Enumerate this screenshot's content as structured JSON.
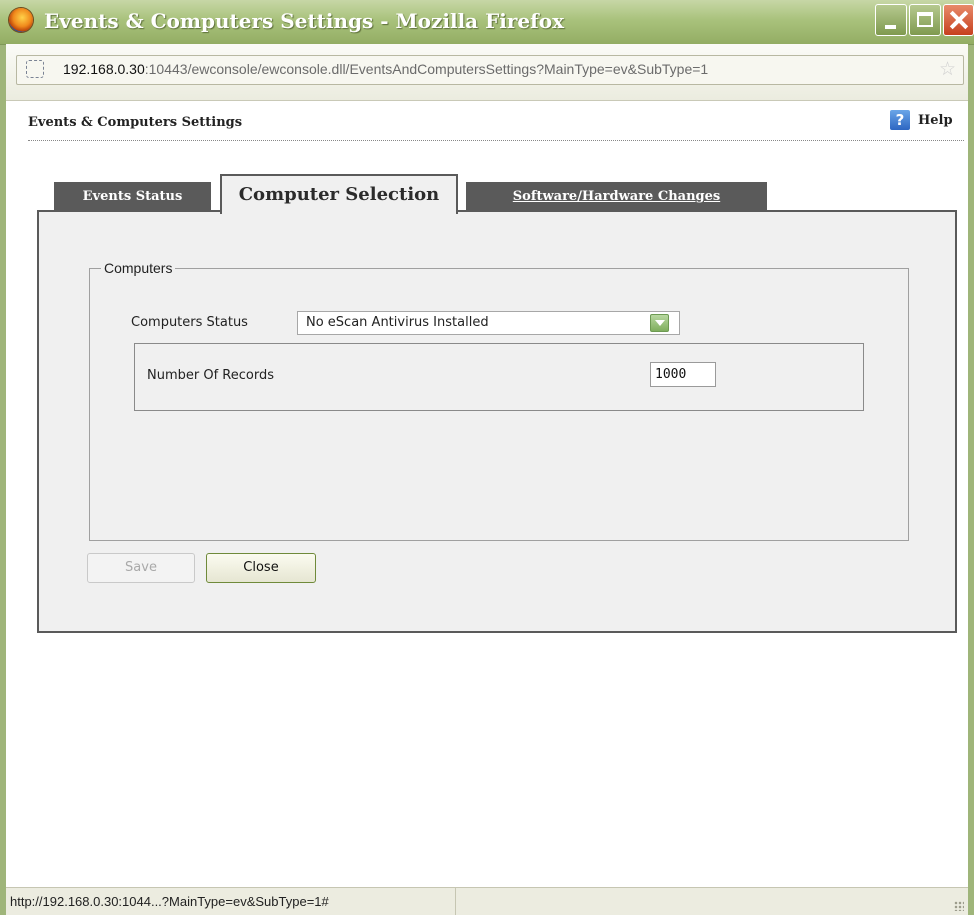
{
  "window": {
    "title": "Events & Computers Settings - Mozilla Firefox"
  },
  "addressbar": {
    "url_host": "192.168.0.30",
    "url_rest": ":10443/ewconsole/ewconsole.dll/EventsAndComputersSettings?MainType=ev&SubType=1"
  },
  "page": {
    "title": "Events & Computers Settings",
    "help_label": "Help",
    "help_icon_glyph": "?"
  },
  "tabs": [
    {
      "label": "Events Status",
      "state": "inactive"
    },
    {
      "label": "Computer Selection",
      "state": "active"
    },
    {
      "label": "Software/Hardware Changes",
      "state": "inactive-link"
    }
  ],
  "computers": {
    "legend": "Computers",
    "status_label": "Computers Status",
    "status_value": "No eScan Antivirus Installed",
    "records_label": "Number Of Records",
    "records_value": "1000"
  },
  "buttons": {
    "save_label": "Save",
    "close_label": "Close"
  },
  "statusbar": {
    "text": "http://192.168.0.30:1044...?MainType=ev&SubType=1#"
  },
  "colors": {
    "titlebar": "#a9c27c",
    "tab_inactive": "#5a5a5a",
    "panel": "#f0f0f0",
    "dropdown_arrow": "#7fae5e"
  },
  "icons": {
    "app": "firefox-icon",
    "site": "site-identity-icon",
    "bookmark": "star-icon",
    "help": "help-icon",
    "dropdown": "chevron-down-icon"
  }
}
